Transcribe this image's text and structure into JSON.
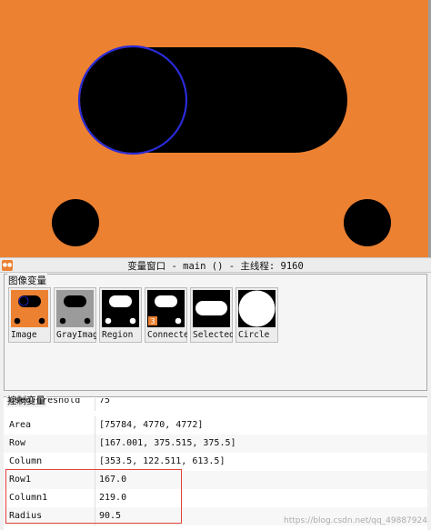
{
  "colors": {
    "background": "#ec8132",
    "shape": "#000000",
    "circle_outline": "#2b2bd8",
    "highlight": "#e0443a"
  },
  "var_window": {
    "title": "变量窗口 - main () - 主线程: 9160",
    "icon": "halcon-app-icon"
  },
  "iconic": {
    "label": "图像变量",
    "items": [
      {
        "label": "Image",
        "icon": "image-thumbnail"
      },
      {
        "label": "GrayImage",
        "icon": "grayimage-thumbnail"
      },
      {
        "label": "Region",
        "icon": "region-thumbnail"
      },
      {
        "label": "ConnectedRegions",
        "icon": "connectedregions-thumbnail"
      },
      {
        "label": "SelectedRegions",
        "icon": "selectedregions-thumbnail"
      },
      {
        "label": "Circle",
        "icon": "circle-thumbnail"
      }
    ]
  },
  "control": {
    "label": "控制变量",
    "rows": [
      {
        "name": "UsedThreshold",
        "value": "75"
      },
      {
        "name": "Area",
        "value": "[75784, 4770, 4772]"
      },
      {
        "name": "Row",
        "value": "[167.001, 375.515, 375.5]"
      },
      {
        "name": "Column",
        "value": "[353.5, 122.511, 613.5]"
      },
      {
        "name": "Row1",
        "value": "167.0"
      },
      {
        "name": "Column1",
        "value": "219.0"
      },
      {
        "name": "Radius",
        "value": "90.5"
      }
    ]
  },
  "watermark": "https://blog.csdn.net/qq_49887924"
}
